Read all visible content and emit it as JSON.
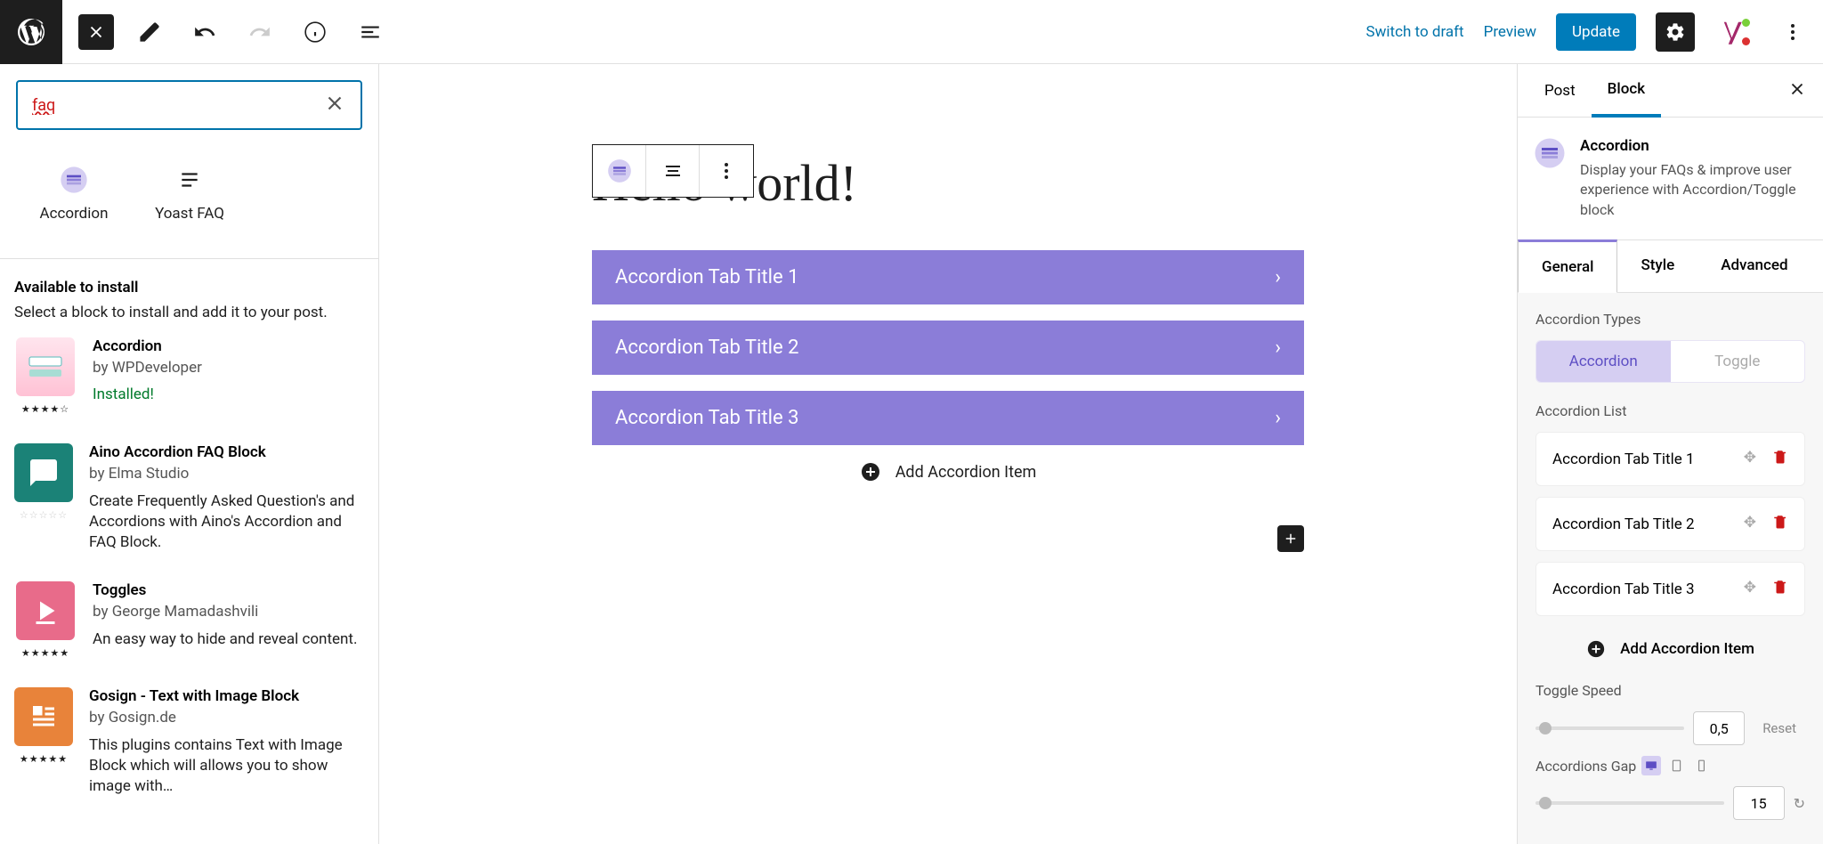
{
  "topbar": {
    "switch_draft": "Switch to draft",
    "preview": "Preview",
    "update": "Update"
  },
  "inserter": {
    "search_value": "faq",
    "blocks": [
      {
        "name": "Accordion"
      },
      {
        "name": "Yoast FAQ"
      }
    ],
    "install_heading": "Available to install",
    "install_sub": "Select a block to install and add it to your post.",
    "plugins": [
      {
        "title": "Accordion",
        "by": "by WPDeveloper",
        "desc": "",
        "installed": "Installed!",
        "stars": "★★★★☆"
      },
      {
        "title": "Aino Accordion FAQ Block",
        "by": "by Elma Studio",
        "desc": "Create Frequently Asked Question's and Accordions with Aino's Accordion and FAQ Block.",
        "installed": "",
        "stars_empty": "☆☆☆☆☆"
      },
      {
        "title": "Toggles",
        "by": "by George Mamadashvili",
        "desc": "An easy way to hide and reveal content.",
        "installed": "",
        "stars": "★★★★★"
      },
      {
        "title": "Gosign - Text with Image Block",
        "by": "by Gosign.de",
        "desc": "This plugins contains Text with Image Block which will allows you to show image with…",
        "installed": "",
        "stars": "★★★★★"
      }
    ]
  },
  "canvas": {
    "h1": "Hello world!",
    "items": [
      "Accordion Tab Title 1",
      "Accordion Tab Title 2",
      "Accordion Tab Title 3"
    ],
    "add_item": "Add Accordion Item"
  },
  "sidebar": {
    "tab_post": "Post",
    "tab_block": "Block",
    "block_name": "Accordion",
    "block_desc": "Display your FAQs & improve user experience with Accordion/Toggle block",
    "subtabs": {
      "general": "General",
      "style": "Style",
      "advanced": "Advanced"
    },
    "types_label": "Accordion Types",
    "type_accordion": "Accordion",
    "type_toggle": "Toggle",
    "list_label": "Accordion List",
    "list": [
      "Accordion Tab Title 1",
      "Accordion Tab Title 2",
      "Accordion Tab Title 3"
    ],
    "add_item": "Add Accordion Item",
    "speed_label": "Toggle Speed",
    "speed_value": "0,5",
    "reset": "Reset",
    "gap_label": "Accordions Gap",
    "gap_value": "15"
  }
}
